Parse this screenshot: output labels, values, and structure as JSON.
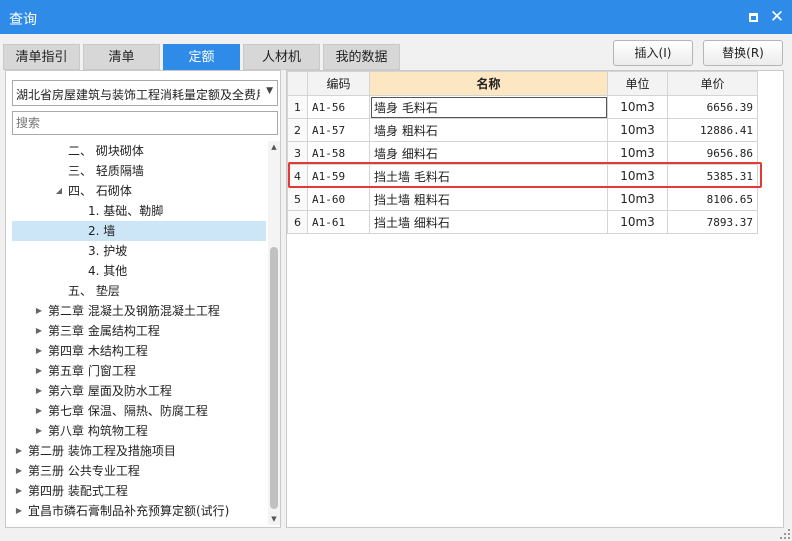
{
  "window": {
    "title": "查询",
    "maximize_icon": "maximize-icon",
    "close_icon": "close-icon",
    "close_glyph": "✕"
  },
  "tabs": [
    {
      "label": "清单指引",
      "active": false
    },
    {
      "label": "清单",
      "active": false
    },
    {
      "label": "定额",
      "active": true
    },
    {
      "label": "人材机",
      "active": false
    },
    {
      "label": "我的数据",
      "active": false
    }
  ],
  "toolbar": {
    "insert_label": "插入(I)",
    "replace_label": "替换(R)"
  },
  "left": {
    "quota_library": "湖北省房屋建筑与装饰工程消耗量定额及全费用",
    "dropdown_icon": "chevron-down-icon",
    "search_placeholder": "搜索",
    "tree": [
      {
        "label": "二、 砌块砌体",
        "level": 3,
        "expander": "",
        "selected": false
      },
      {
        "label": "三、 轻质隔墙",
        "level": 3,
        "expander": "",
        "selected": false
      },
      {
        "label": "四、 石砌体",
        "level": 3,
        "expander": "◢",
        "selected": false
      },
      {
        "label": "1. 基础、勒脚",
        "level": 4,
        "expander": "",
        "selected": false
      },
      {
        "label": "2. 墙",
        "level": 4,
        "expander": "",
        "selected": true
      },
      {
        "label": "3. 护坡",
        "level": 4,
        "expander": "",
        "selected": false
      },
      {
        "label": "4. 其他",
        "level": 4,
        "expander": "",
        "selected": false
      },
      {
        "label": "五、 垫层",
        "level": 3,
        "expander": "",
        "selected": false
      },
      {
        "label": "第二章 混凝土及钢筋混凝土工程",
        "level": 2,
        "expander": "▶",
        "selected": false
      },
      {
        "label": "第三章 金属结构工程",
        "level": 2,
        "expander": "▶",
        "selected": false
      },
      {
        "label": "第四章 木结构工程",
        "level": 2,
        "expander": "▶",
        "selected": false
      },
      {
        "label": "第五章 门窗工程",
        "level": 2,
        "expander": "▶",
        "selected": false
      },
      {
        "label": "第六章 屋面及防水工程",
        "level": 2,
        "expander": "▶",
        "selected": false
      },
      {
        "label": "第七章 保温、隔热、防腐工程",
        "level": 2,
        "expander": "▶",
        "selected": false
      },
      {
        "label": "第八章 构筑物工程",
        "level": 2,
        "expander": "▶",
        "selected": false
      },
      {
        "label": "第二册 装饰工程及措施项目",
        "level": 1,
        "expander": "▶",
        "selected": false
      },
      {
        "label": "第三册 公共专业工程",
        "level": 1,
        "expander": "▶",
        "selected": false
      },
      {
        "label": "第四册 装配式工程",
        "level": 1,
        "expander": "▶",
        "selected": false
      },
      {
        "label": "宜昌市磷石膏制品补充预算定额(试行)",
        "level": 1,
        "expander": "▶",
        "selected": false
      }
    ]
  },
  "grid": {
    "headers": {
      "code": "编码",
      "name": "名称",
      "unit": "单位",
      "price": "单价"
    },
    "rows": [
      {
        "no": "1",
        "code": "A1-56",
        "name": "墙身 毛料石",
        "unit": "10m3",
        "price": "6656.39",
        "current": true,
        "highlighted": false
      },
      {
        "no": "2",
        "code": "A1-57",
        "name": "墙身 粗料石",
        "unit": "10m3",
        "price": "12886.41",
        "current": false,
        "highlighted": false
      },
      {
        "no": "3",
        "code": "A1-58",
        "name": "墙身 细料石",
        "unit": "10m3",
        "price": "9656.86",
        "current": false,
        "highlighted": false
      },
      {
        "no": "4",
        "code": "A1-59",
        "name": "挡土墙 毛料石",
        "unit": "10m3",
        "price": "5385.31",
        "current": false,
        "highlighted": true
      },
      {
        "no": "5",
        "code": "A1-60",
        "name": "挡土墙 粗料石",
        "unit": "10m3",
        "price": "8106.65",
        "current": false,
        "highlighted": false
      },
      {
        "no": "6",
        "code": "A1-61",
        "name": "挡土墙 细料石",
        "unit": "10m3",
        "price": "7893.37",
        "current": false,
        "highlighted": false
      }
    ]
  },
  "colors": {
    "accent": "#2e8be8",
    "selection": "#cde6f7",
    "highlight_border": "#e53935",
    "header_highlight": "#fde7c3"
  }
}
